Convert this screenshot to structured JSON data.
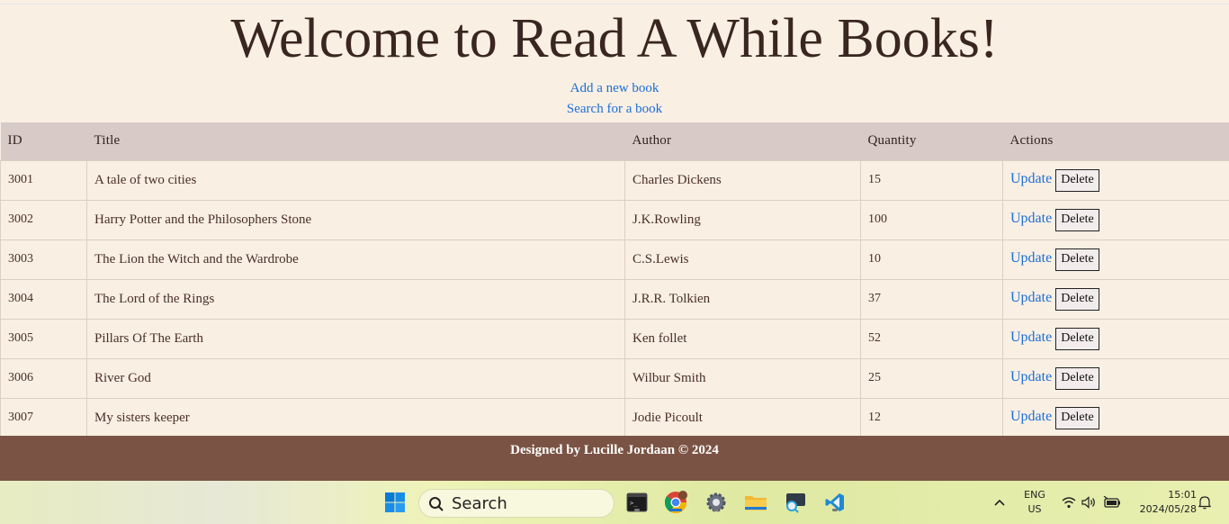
{
  "page": {
    "heading": "Welcome to Read A While Books!",
    "links": {
      "add": "Add a new book",
      "search": "Search for a book"
    }
  },
  "table": {
    "headers": [
      "ID",
      "Title",
      "Author",
      "Quantity",
      "Actions"
    ],
    "rows": [
      {
        "id": "3001",
        "title": "A tale of two cities",
        "author": "Charles Dickens",
        "quantity": "15",
        "update": "Update",
        "delete": "Delete"
      },
      {
        "id": "3002",
        "title": "Harry Potter and the Philosophers Stone",
        "author": "J.K.Rowling",
        "quantity": "100",
        "update": "Update",
        "delete": "Delete"
      },
      {
        "id": "3003",
        "title": "The Lion the Witch and the Wardrobe",
        "author": "C.S.Lewis",
        "quantity": "10",
        "update": "Update",
        "delete": "Delete"
      },
      {
        "id": "3004",
        "title": "The Lord of the Rings",
        "author": "J.R.R. Tolkien",
        "quantity": "37",
        "update": "Update",
        "delete": "Delete"
      },
      {
        "id": "3005",
        "title": "Pillars Of The Earth",
        "author": "Ken follet",
        "quantity": "52",
        "update": "Update",
        "delete": "Delete"
      },
      {
        "id": "3006",
        "title": "River God",
        "author": "Wilbur Smith",
        "quantity": "25",
        "update": "Update",
        "delete": "Delete"
      },
      {
        "id": "3007",
        "title": "My sisters keeper",
        "author": "Jodie Picoult",
        "quantity": "12",
        "update": "Update",
        "delete": "Delete"
      }
    ]
  },
  "footer": {
    "text": "Designed by Lucille Jordaan © 2024"
  },
  "taskbar": {
    "search_label": "Search",
    "language_line1": "ENG",
    "language_line2": "US",
    "time": "15:01",
    "date": "2024/05/28",
    "apps": [
      "windows-start-icon",
      "terminal-icon",
      "chrome-icon",
      "settings-icon",
      "file-explorer-icon",
      "remote-desktop-icon",
      "vscode-icon"
    ]
  },
  "colors": {
    "background": "#f9efe3",
    "header_row": "#d8cbc7",
    "link": "#1a6fd6",
    "footer": "#7b5344",
    "text": "#4a2f27"
  }
}
